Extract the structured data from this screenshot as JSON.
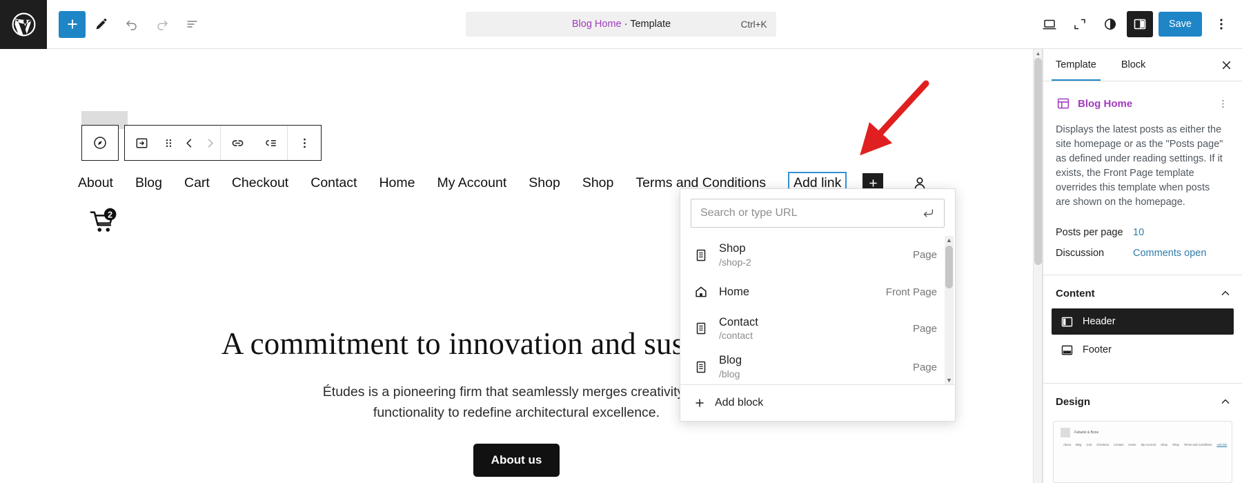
{
  "topbar": {
    "logo_name": "wordpress-logo",
    "add_block_label": "+",
    "command_title_accent": "Blog Home",
    "command_title_rest": " · Template",
    "command_shortcut": "Ctrl+K",
    "save_label": "Save"
  },
  "canvas": {
    "nav_items": [
      "About",
      "Blog",
      "Cart",
      "Checkout",
      "Contact",
      "Home",
      "My Account",
      "Shop",
      "Shop",
      "Terms and Conditions"
    ],
    "add_link_label": "Add link",
    "cart_badge": "2",
    "hero_heading": "A commitment to innovation and sustainability",
    "hero_paragraph": "Études is a pioneering firm that seamlessly merges creativity and functionality to redefine architectural excellence.",
    "hero_button": "About us"
  },
  "link_popover": {
    "search_placeholder": "Search or type URL",
    "search_value": "",
    "results": [
      {
        "title": "Shop",
        "url": "/shop-2",
        "type": "Page",
        "icon": "page-icon"
      },
      {
        "title": "Home",
        "url": "",
        "type": "Front Page",
        "icon": "home-icon"
      },
      {
        "title": "Contact",
        "url": "/contact",
        "type": "Page",
        "icon": "page-icon"
      },
      {
        "title": "Blog",
        "url": "/blog",
        "type": "Page",
        "icon": "page-icon"
      }
    ],
    "add_block_label": "Add block"
  },
  "sidebar": {
    "tabs": [
      {
        "label": "Template",
        "active": true
      },
      {
        "label": "Block",
        "active": false
      }
    ],
    "template_title": "Blog Home",
    "description": "Displays the latest posts as either the site homepage or as the \"Posts page\" as defined under reading settings. If it exists, the Front Page template overrides this template when posts are shown on the homepage.",
    "properties": [
      {
        "key": "Posts per page",
        "value": "10"
      },
      {
        "key": "Discussion",
        "value": "Comments open"
      }
    ],
    "content_section": {
      "title": "Content",
      "items": [
        {
          "label": "Header",
          "selected": true
        },
        {
          "label": "Footer",
          "selected": false
        }
      ]
    },
    "design_section": {
      "title": "Design",
      "preview_brand": "Fabulist & Bone",
      "preview_nav": [
        "About",
        "Blog",
        "Cart",
        "Checkout",
        "Contact",
        "Home",
        "My Account",
        "Shop",
        "Shop",
        "Terms and Conditions"
      ],
      "preview_nav_hl": "Add link"
    }
  },
  "colors": {
    "accent_blue": "#1e86c7",
    "purple": "#a23bbd",
    "link_blue": "#2e7ca8",
    "dark": "#1e1e1e",
    "annotation_red": "#e02020"
  }
}
